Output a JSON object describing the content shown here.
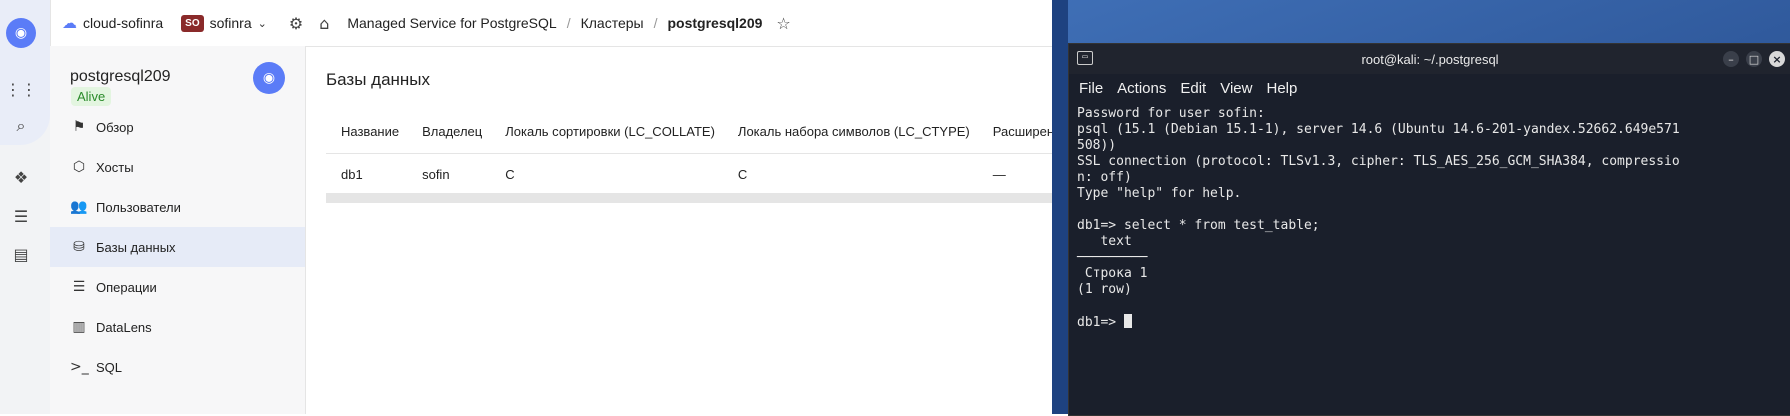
{
  "topbar": {
    "cloud_label": "cloud-sofinra",
    "account_badge": "SO",
    "account_name": "sofinra",
    "breadcrumbs": [
      "Managed Service for PostgreSQL",
      "Кластеры",
      "postgresql209"
    ]
  },
  "sidebar": {
    "cluster_name": "postgresql209",
    "status": "Alive",
    "items": [
      {
        "label": "Обзор",
        "icon": "overview-icon"
      },
      {
        "label": "Хосты",
        "icon": "hosts-icon"
      },
      {
        "label": "Пользователи",
        "icon": "users-icon"
      },
      {
        "label": "Базы данных",
        "icon": "database-icon",
        "active": true
      },
      {
        "label": "Операции",
        "icon": "operations-icon"
      },
      {
        "label": "DataLens",
        "icon": "datalens-icon"
      },
      {
        "label": "SQL",
        "icon": "sql-icon"
      }
    ]
  },
  "main": {
    "title": "Базы данных",
    "columns": [
      "Название",
      "Владелец",
      "Локаль сортировки (LC_COLLATE)",
      "Локаль набора символов (LC_CTYPE)",
      "Расширен"
    ],
    "rows": [
      [
        "db1",
        "sofin",
        "C",
        "C",
        "—"
      ]
    ]
  },
  "terminal": {
    "title": "root@kali: ~/.postgresql",
    "menu": [
      "File",
      "Actions",
      "Edit",
      "View",
      "Help"
    ],
    "lines": [
      "Password for user sofin:",
      "psql (15.1 (Debian 15.1-1), server 14.6 (Ubuntu 14.6-201-yandex.52662.649e571",
      "508))",
      "SSL connection (protocol: TLSv1.3, cipher: TLS_AES_256_GCM_SHA384, compressio",
      "n: off)",
      "Type \"help\" for help.",
      "",
      "db1=> select * from test_table;",
      "   text",
      "─────────",
      " Строка 1",
      "(1 row)",
      ""
    ],
    "prompt": "db1=> "
  },
  "colors": {
    "accent": "#5b7cf7",
    "alive_green": "#2a8a2a",
    "terminal_bg": "#1a1f2b"
  }
}
